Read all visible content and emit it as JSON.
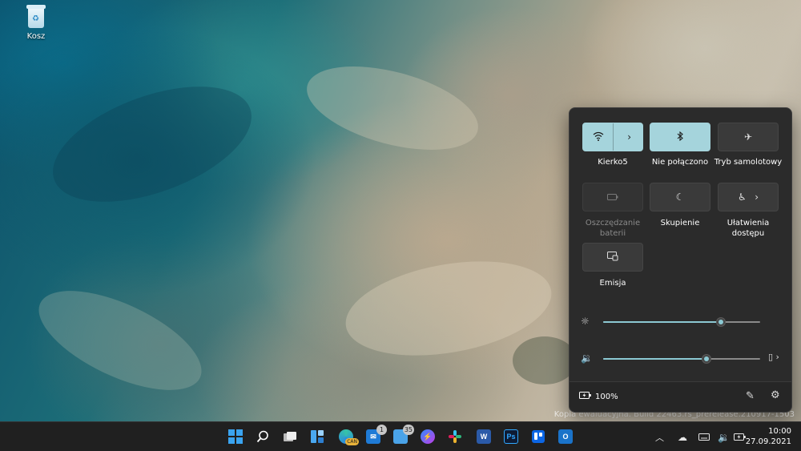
{
  "desktop": {
    "icons": [
      {
        "label": "Kosz",
        "icon": "recycle-bin-icon"
      }
    ],
    "watermark": "Kopia ewaluacyjna. Build 22463.rs_prerelease.210917-1503"
  },
  "quick_settings": {
    "tiles": [
      {
        "id": "wifi",
        "label": "Kierko5",
        "icon": "wifi-icon",
        "state": "on",
        "has_chevron": true
      },
      {
        "id": "bluetooth",
        "label": "Nie połączono",
        "icon": "bluetooth-icon",
        "state": "on"
      },
      {
        "id": "airplane",
        "label": "Tryb samolotowy",
        "icon": "airplane-icon",
        "state": "off"
      },
      {
        "id": "battery-saver",
        "label": "Oszczędzanie baterii",
        "icon": "battery-saver-icon",
        "state": "disabled"
      },
      {
        "id": "focus",
        "label": "Skupienie",
        "icon": "moon-icon",
        "state": "off"
      },
      {
        "id": "accessibility",
        "label": "Ułatwienia dostępu",
        "icon": "accessibility-icon",
        "state": "off",
        "has_chevron": true
      },
      {
        "id": "cast",
        "label": "Emisja",
        "icon": "cast-icon",
        "state": "off"
      }
    ],
    "brightness": {
      "icon": "brightness-icon",
      "value_percent": 75
    },
    "volume": {
      "icon": "speaker-icon",
      "value_percent": 66,
      "output_icon": "speaker-device-icon"
    },
    "footer": {
      "battery_text": "100%",
      "battery_icon": "battery-charging-icon",
      "edit_icon": "pencil-icon",
      "settings_icon": "gear-icon"
    }
  },
  "taskbar": {
    "apps": [
      {
        "name": "start",
        "icon": "windows-start-icon"
      },
      {
        "name": "search",
        "icon": "search-icon"
      },
      {
        "name": "task-view",
        "icon": "task-view-icon"
      },
      {
        "name": "widgets",
        "icon": "widgets-icon"
      },
      {
        "name": "edge",
        "icon": "edge-icon",
        "tag": "CAN"
      },
      {
        "name": "mail",
        "icon": "mail-icon",
        "badge": "1"
      },
      {
        "name": "teams",
        "icon": "teams-icon",
        "badge": "35"
      },
      {
        "name": "messenger",
        "icon": "messenger-icon"
      },
      {
        "name": "slack",
        "icon": "slack-icon"
      },
      {
        "name": "word",
        "icon": "word-icon",
        "glyph": "W"
      },
      {
        "name": "photoshop",
        "icon": "photoshop-icon",
        "glyph": "Ps"
      },
      {
        "name": "trello",
        "icon": "trello-icon"
      },
      {
        "name": "outlook",
        "icon": "outlook-icon",
        "glyph": "O"
      }
    ],
    "tray": {
      "chevron": "chevron-up-icon",
      "cloud": "cloud-icon",
      "keyboard": "keyboard-icon",
      "volume": "speaker-icon",
      "battery": "battery-charging-icon"
    },
    "clock": {
      "time": "10:00",
      "date": "27.09.2021"
    }
  }
}
